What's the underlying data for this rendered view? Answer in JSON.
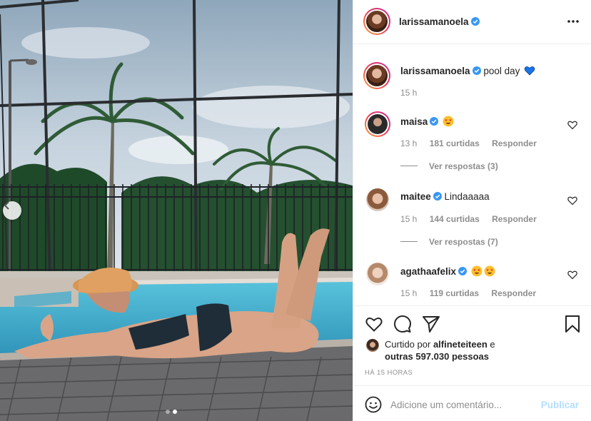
{
  "post": {
    "author": "larissamanoela",
    "verified": true,
    "caption_text": "pool day",
    "caption_emoji": "blue-heart",
    "caption_time": "15 h",
    "media": {
      "carousel_index": 2,
      "carousel_count": 2
    }
  },
  "comments": [
    {
      "username": "maisa",
      "verified": true,
      "text": "",
      "emojis": [
        "star-struck"
      ],
      "time": "13 h",
      "likes": "181 curtidas",
      "reply_label": "Responder",
      "view_replies": "Ver respostas (3)",
      "has_story_ring": true
    },
    {
      "username": "maitee",
      "verified": true,
      "text": "Lindaaaaa",
      "emojis": [],
      "time": "15 h",
      "likes": "144 curtidas",
      "reply_label": "Responder",
      "view_replies": "Ver respostas (7)",
      "has_story_ring": false
    },
    {
      "username": "agathaafelix",
      "verified": true,
      "text": "",
      "emojis": [
        "star-struck",
        "star-struck"
      ],
      "time": "15 h",
      "likes": "119 curtidas",
      "reply_label": "Responder",
      "has_story_ring": false
    }
  ],
  "likes": {
    "prefix": "Curtido por",
    "liker": "alfineteiteen",
    "conjunction": "e",
    "others": "outras 597.030 pessoas"
  },
  "timestamp": "HÁ 15 HORAS",
  "add_comment": {
    "placeholder": "Adicione um comentário...",
    "post_label": "Publicar"
  },
  "icons": {
    "like": "heart-icon",
    "comment": "comment-icon",
    "share": "share-icon",
    "save": "bookmark-icon",
    "more": "more-options-icon",
    "emoji": "emoji-icon",
    "prev": "chevron-left-icon"
  },
  "colors": {
    "verified": "#3897f0",
    "link": "#b2dffc",
    "muted": "#8e8e8e",
    "text": "#262626"
  }
}
